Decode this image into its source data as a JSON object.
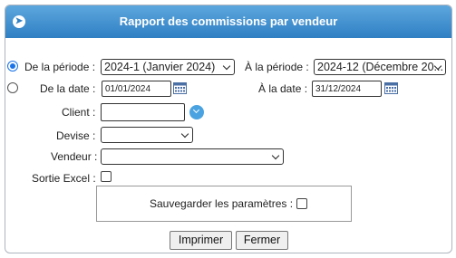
{
  "title": "Rapport des commissions par vendeur",
  "icons": {
    "header": "circle-arrow-right-icon",
    "calendar": "calendar-icon",
    "client_dropdown": "chevron-down-circle-icon"
  },
  "colors": {
    "header_top": "#5da7de",
    "header_bottom": "#2f7fc3",
    "radio_selected": "#1a73e8"
  },
  "period": {
    "from_label": "De la période :",
    "from_value": "2024-1 (Janvier 2024)",
    "to_label": "À la période :",
    "to_value": "2024-12 (Décembre 20..."
  },
  "date": {
    "from_label": "De la date :",
    "from_value": "01/01/2024",
    "to_label": "À la date :",
    "to_value": "31/12/2024"
  },
  "client": {
    "label": "Client :",
    "value": ""
  },
  "devise": {
    "label": "Devise :",
    "value": ""
  },
  "vendeur": {
    "label": "Vendeur :",
    "value": ""
  },
  "excel": {
    "label": "Sortie Excel :"
  },
  "save_params": {
    "label": "Sauvegarder les paramètres :"
  },
  "buttons": {
    "print": "Imprimer",
    "close": "Fermer"
  }
}
